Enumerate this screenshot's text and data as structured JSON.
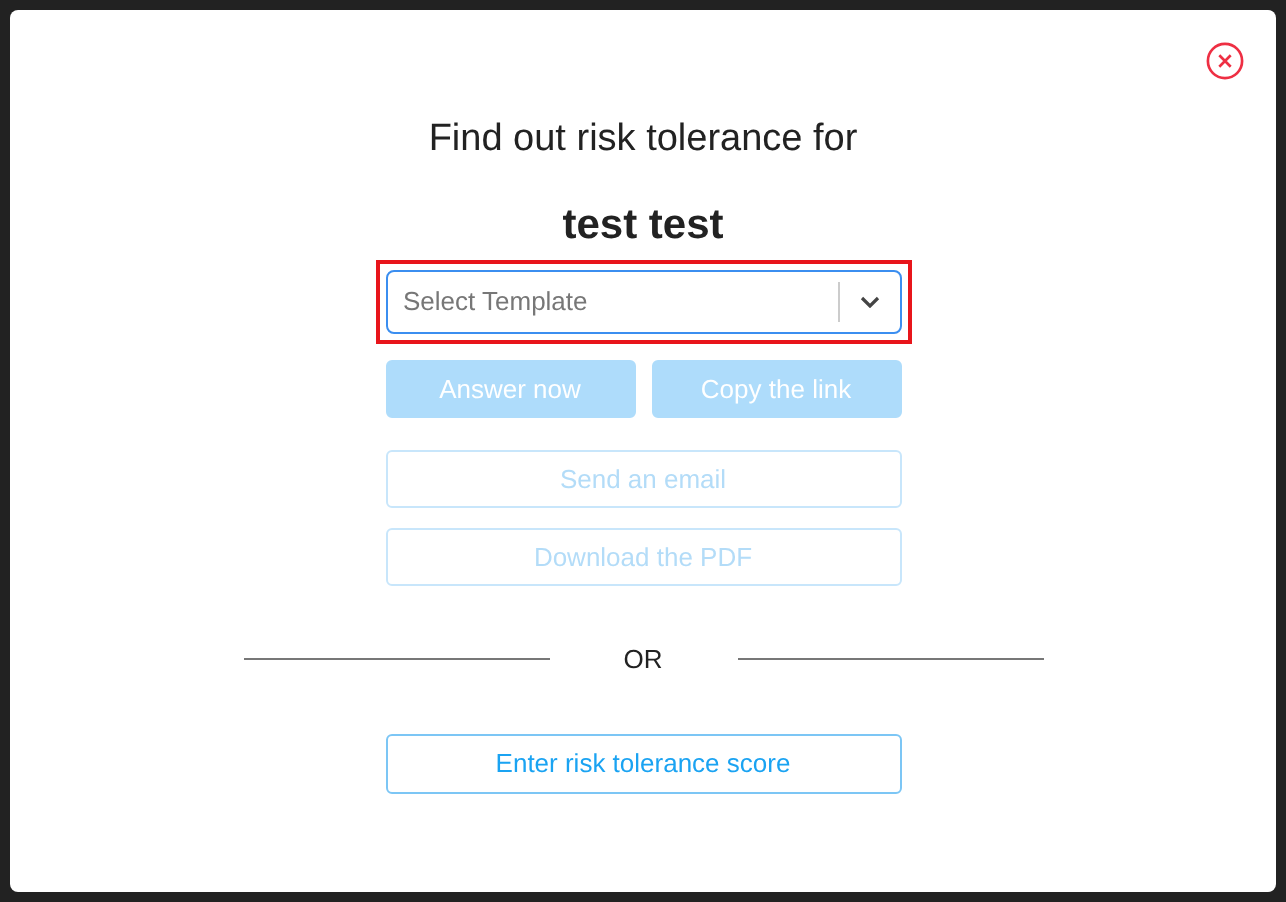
{
  "dialog": {
    "title": "Find out risk tolerance for",
    "client_name": "test test",
    "template_select": {
      "placeholder": "Select Template",
      "highlighted": true
    },
    "buttons": [
      {
        "label": "Answer now",
        "kind": "filled",
        "disabled": true
      },
      {
        "label": "Copy the link",
        "kind": "filled",
        "disabled": true
      },
      {
        "label": "Send an email",
        "kind": "outline",
        "disabled": true
      },
      {
        "label": "Download the PDF",
        "kind": "outline",
        "disabled": true
      }
    ],
    "separator": "OR",
    "score_button": {
      "label": "Enter risk tolerance score",
      "disabled": false
    }
  }
}
